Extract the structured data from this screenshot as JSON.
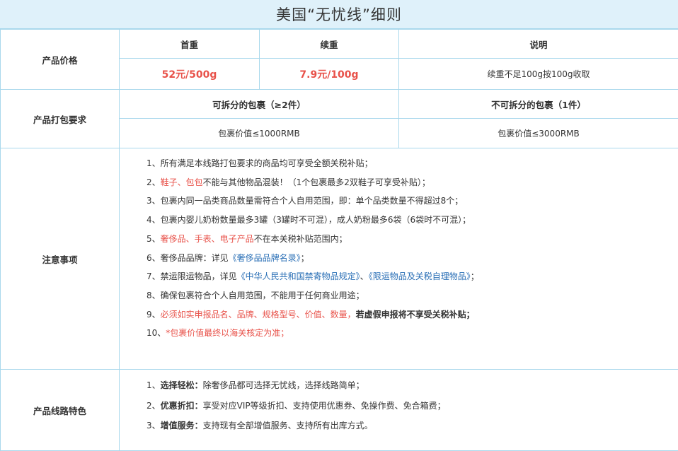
{
  "title": "美国“无忧线”细则",
  "price": {
    "label": "产品价格",
    "headers": [
      "首重",
      "续重",
      "说明"
    ],
    "first_weight": "52元/500g",
    "extra_weight": "7.9元/100g",
    "note": "续重不足100g按100g收取"
  },
  "packing": {
    "label": "产品打包要求",
    "headers": [
      "可拆分的包裹（≥2件）",
      "不可拆分的包裹（1件）"
    ],
    "values": [
      "包裹价值≤1000RMB",
      "包裹价值≤3000RMB"
    ]
  },
  "notes": {
    "label": "注意事项",
    "items": [
      {
        "n": "1、",
        "parts": [
          {
            "t": "所有满足本线路打包要求的商品均可享受全额关税补贴；",
            "c": ""
          }
        ]
      },
      {
        "n": "2、",
        "parts": [
          {
            "t": "鞋子、包包",
            "c": "red"
          },
          {
            "t": "不能与其他物品混装！（1个包裹最多2双鞋子可享受补贴）；",
            "c": ""
          }
        ]
      },
      {
        "n": "3、",
        "parts": [
          {
            "t": "包裹内同一品类商品数量需符合个人自用范围，即：单个品类数量不得超过8个；",
            "c": ""
          }
        ]
      },
      {
        "n": "4、",
        "parts": [
          {
            "t": "包裹内婴儿奶粉数量最多3罐（3罐时不可混），成人奶粉最多6袋（6袋时不可混）；",
            "c": ""
          }
        ]
      },
      {
        "n": "5、",
        "parts": [
          {
            "t": "奢侈品、手表、电子产品",
            "c": "red"
          },
          {
            "t": "不在本关税补贴范围内；",
            "c": ""
          }
        ]
      },
      {
        "n": "6、",
        "parts": [
          {
            "t": "奢侈品品牌：详见",
            "c": ""
          },
          {
            "t": "《奢侈品品牌名录》",
            "c": "blue"
          },
          {
            "t": "；",
            "c": ""
          }
        ]
      },
      {
        "n": "7、",
        "parts": [
          {
            "t": "禁运限运物品，详见",
            "c": ""
          },
          {
            "t": "《中华人民共和国禁寄物品规定》",
            "c": "blue"
          },
          {
            "t": "、",
            "c": ""
          },
          {
            "t": "《限运物品及关税自理物品》",
            "c": "blue"
          },
          {
            "t": "；",
            "c": ""
          }
        ]
      },
      {
        "n": "8、",
        "parts": [
          {
            "t": "确保包裹符合个人自用范围，不能用于任何商业用途；",
            "c": ""
          }
        ]
      },
      {
        "n": "9、",
        "parts": [
          {
            "t": "必须如实申报品名、品牌、规格型号、价值、数量，",
            "c": "red"
          },
          {
            "t": "若虚假申报将不享受关税补贴；",
            "c": "bold"
          }
        ]
      },
      {
        "n": "10、",
        "parts": [
          {
            "t": "*包裹价值最终以海关核定为准；",
            "c": "red"
          }
        ]
      }
    ]
  },
  "features": {
    "label": "产品线路特色",
    "items": [
      {
        "n": "1、",
        "key": "选择轻松：",
        "text": "除奢侈品都可选择无忧线，选择线路简单；"
      },
      {
        "n": "2、",
        "key": "优惠折扣：",
        "text": "享受对应VIP等级折扣、支持使用优惠券、免操作费、免合箱费；"
      },
      {
        "n": "3、",
        "key": "增值服务：",
        "text": "支持现有全部增值服务、支持所有出库方式。"
      }
    ]
  }
}
